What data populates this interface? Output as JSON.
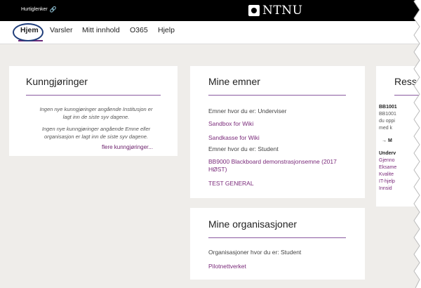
{
  "topbar": {
    "quicklinks_label": "Hurtiglenker",
    "quicklinks_icon": "link-icon",
    "logo_text": "NTNU"
  },
  "nav": {
    "items": [
      {
        "label": "Hjem",
        "active": true
      },
      {
        "label": "Varsler"
      },
      {
        "label": "Mitt innhold"
      },
      {
        "label": "O365"
      },
      {
        "label": "Hjelp"
      }
    ]
  },
  "announcements": {
    "title": "Kunngjøringer",
    "msg1_line1": "Ingen nye kunngjøringer angående Institusjon er",
    "msg1_line2": "lagt inn de siste syv dagene.",
    "msg2_line1": "Ingen nye kunngjøringer angående Emne eller",
    "msg2_line2": "organisasjon er lagt inn de siste syv dagene.",
    "more_link": "flere kunngjøringer..."
  },
  "courses": {
    "title": "Mine emner",
    "role_teacher": "Emner hvor du er: Underviser",
    "link1": "Sandbox for Wiki",
    "link2": "Sandkasse for Wiki",
    "role_student": "Emner hvor du er: Student",
    "link3_line1": "BB9000 Blackboard demonstrasjonsemne (2017",
    "link3_line2": "HØST)",
    "link4": "TEST GENERAL"
  },
  "organisations": {
    "title": "Mine organisasjoner",
    "role_student": "Organisasjoner hvor du er: Student",
    "link1": "Pilotnettverket"
  },
  "resources": {
    "title": "Ress",
    "line1": "BB1001",
    "line2": "BB1001",
    "line3": "du oppi",
    "line4": "med k",
    "arrow_link": "→ M",
    "section": "Underv",
    "link1": "Gjenno",
    "link2": "Eksame",
    "link3": "Kvalite",
    "link4": "IT-hjelp",
    "link5": "Innsid"
  },
  "colors": {
    "accent": "#7a2a7a",
    "nav_highlight": "#1f3d7a",
    "page_bg": "#efedea"
  }
}
